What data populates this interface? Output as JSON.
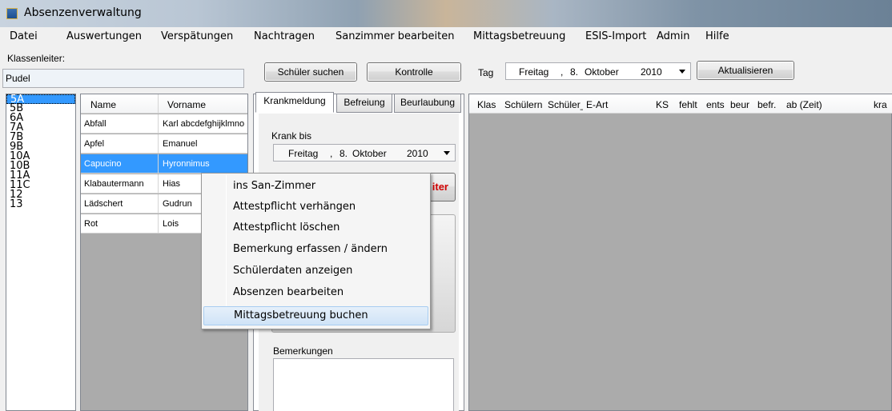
{
  "window": {
    "title": "Absenzenverwaltung"
  },
  "menu": [
    "Datei",
    "Auswertungen",
    "Verspätungen",
    "Nachtragen",
    "Sanzimmer bearbeiten",
    "Mittagsbetreuung",
    "ESIS-Import",
    "Admin",
    "Hilfe"
  ],
  "klassenleiter": {
    "label": "Klassenleiter:",
    "value": "Pudel"
  },
  "toolbar": {
    "search_label": "Schüler suchen",
    "control_label": "Kontrolle",
    "tag_label": "Tag",
    "refresh_label": "Aktualisieren"
  },
  "date": {
    "weekday": "Freitag",
    "day": "8.",
    "month": "Oktober",
    "year": "2010"
  },
  "classes": [
    "5A",
    "5B",
    "6A",
    "7A",
    "7B",
    "9B",
    "10A",
    "10B",
    "11A",
    "11C",
    "12",
    "13"
  ],
  "selected_class": "5A",
  "students": {
    "headers": [
      "Name",
      "Vorname"
    ],
    "rows": [
      {
        "name": "Abfall",
        "vorname": "Karl abcdefghijklmno"
      },
      {
        "name": "Apfel",
        "vorname": "Emanuel"
      },
      {
        "name": "Capucino",
        "vorname": "Hyronnimus"
      },
      {
        "name": "Klabautermann",
        "vorname": "Hias"
      },
      {
        "name": "Lädschert",
        "vorname": "Gudrun"
      },
      {
        "name": "Rot",
        "vorname": "Lois"
      }
    ],
    "selected_index": 2
  },
  "tabs": [
    "Krankmeldung",
    "Befreiung",
    "Beurlaubung"
  ],
  "krank": {
    "label": "Krank bis",
    "weekday": "Freitag",
    "day": "8.",
    "month": "Oktober",
    "year": "2010",
    "partial_button": "iter",
    "remarks_label": "Bemerkungen"
  },
  "absences_headers": [
    "Klas",
    "Schülern",
    "Schüler_",
    "E-Art",
    "KS",
    "fehlt",
    "ents",
    "beur",
    "befr.",
    "ab (Zeit)",
    "kra"
  ],
  "context_menu": [
    "ins San-Zimmer",
    "Attestpflicht verhängen",
    "Attestpflicht löschen",
    "Bemerkung erfassen / ändern",
    "Schülerdaten anzeigen",
    "Absenzen bearbeiten",
    "Mittagsbetreuung buchen"
  ],
  "context_menu_highlighted": "Mittagsbetreuung buchen",
  "colors": {
    "selection": "#3399ff",
    "partial_button_text": "#d00000",
    "grid_background": "#ababab"
  }
}
